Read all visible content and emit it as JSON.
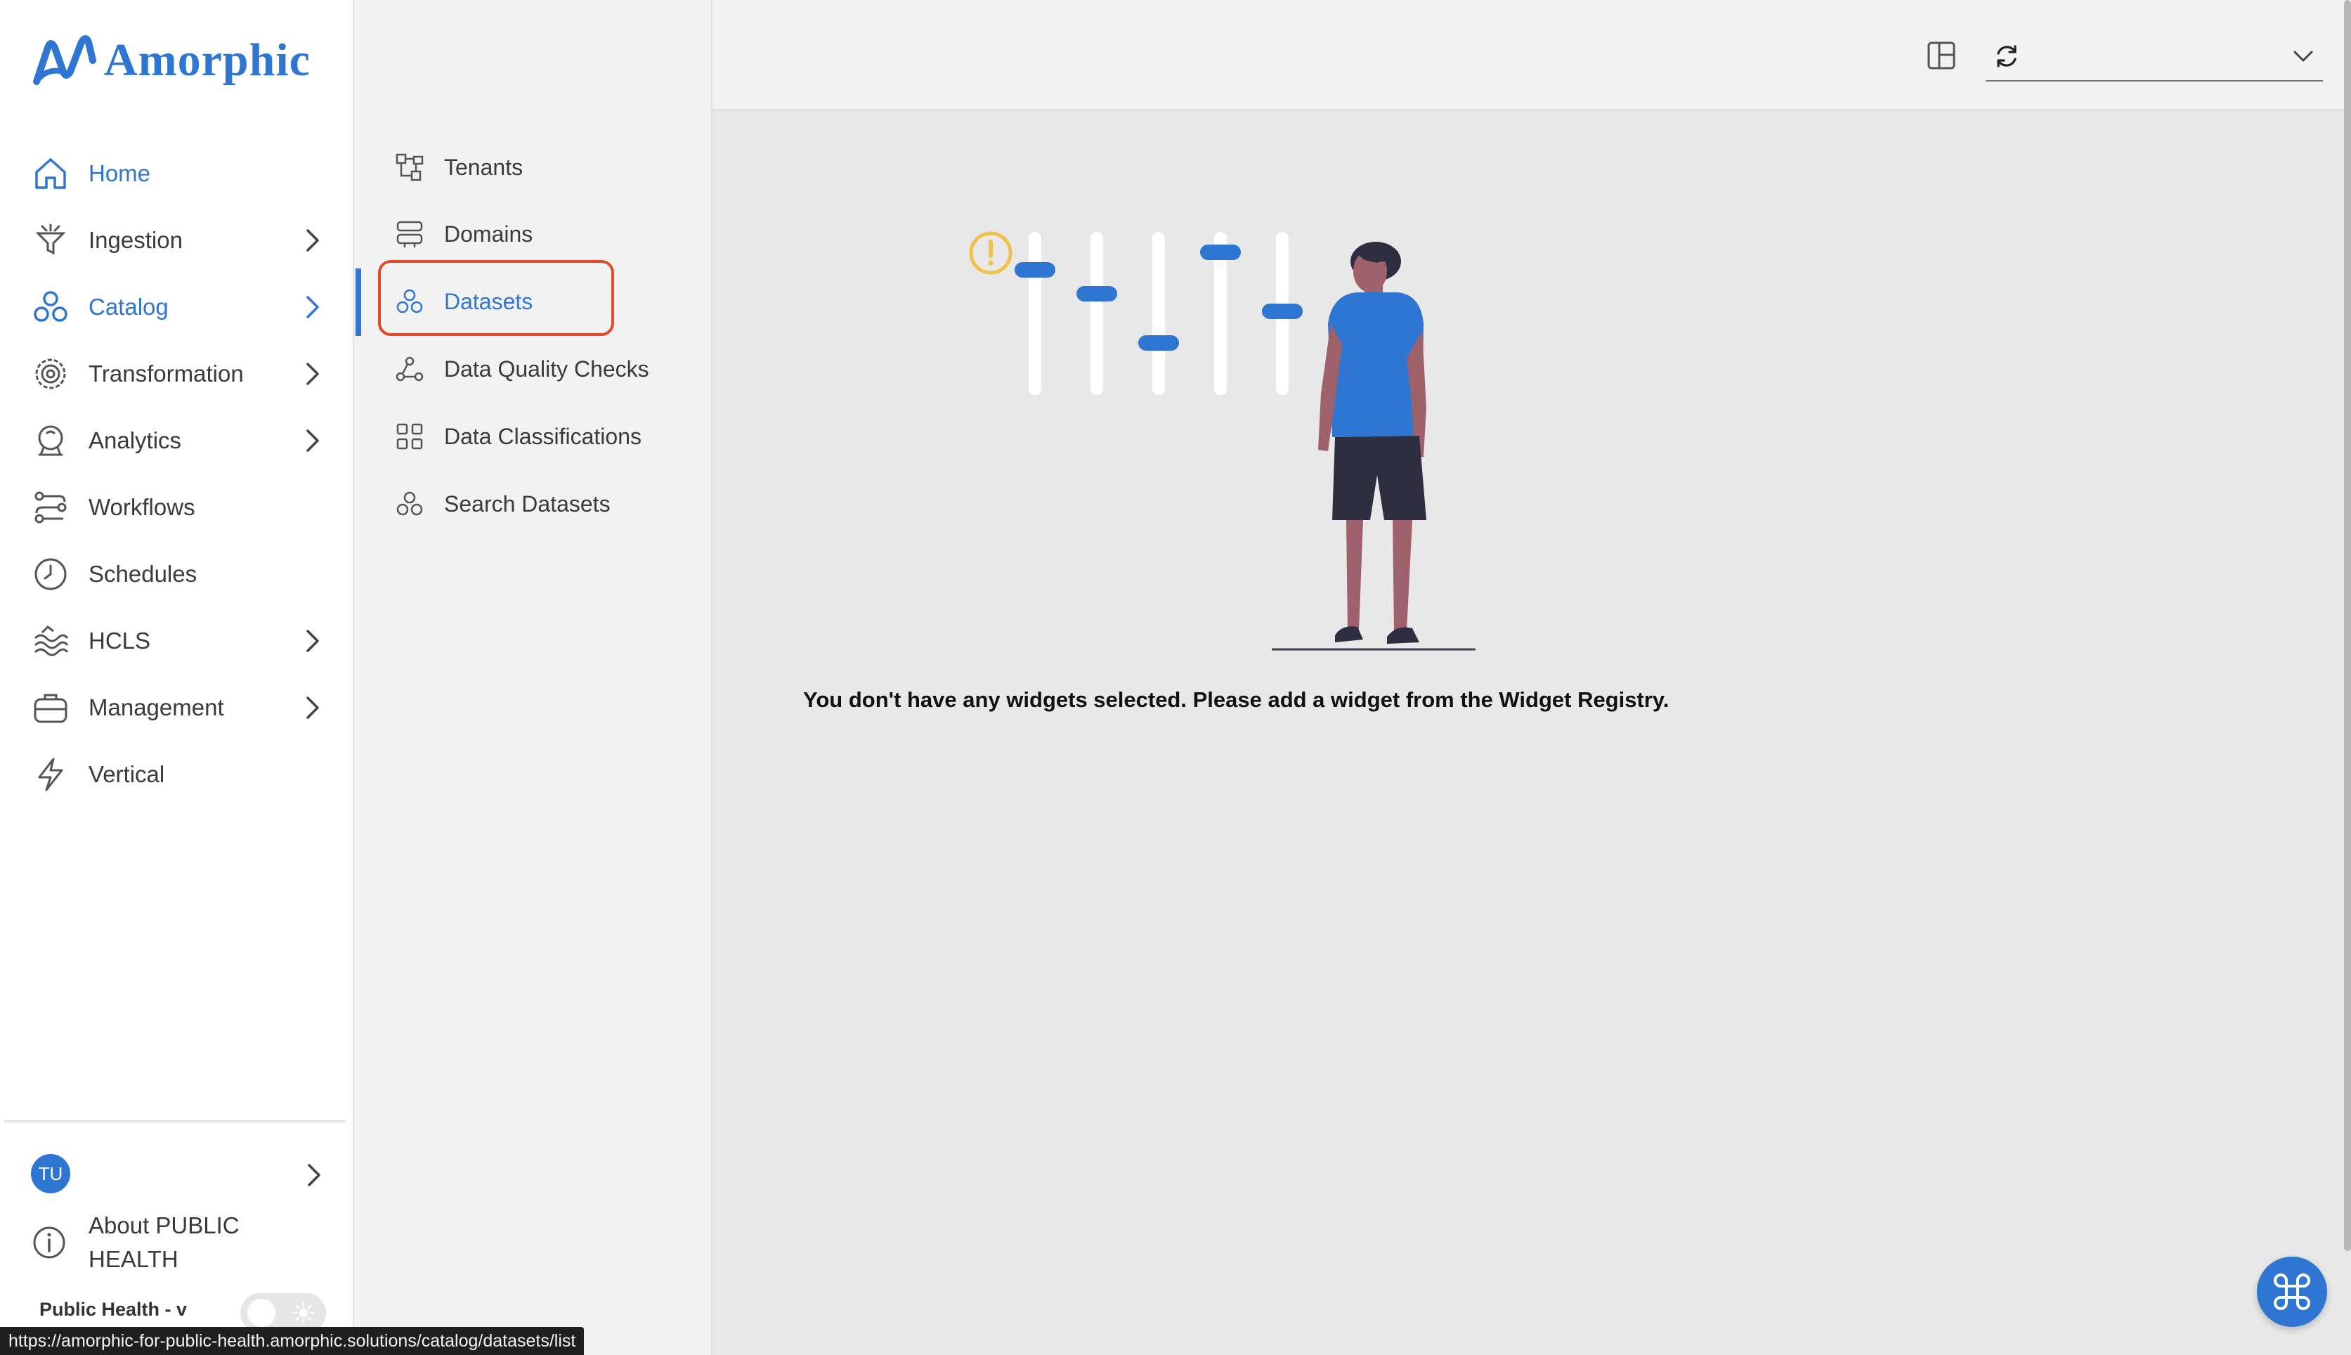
{
  "brand": {
    "name": "Amorphic",
    "accent": "#2f76d2"
  },
  "sidebar": {
    "items": [
      {
        "label": "Home",
        "icon": "home-icon",
        "active": true,
        "has_children": false
      },
      {
        "label": "Ingestion",
        "icon": "funnel-icon",
        "active": false,
        "has_children": true
      },
      {
        "label": "Catalog",
        "icon": "catalog-icon",
        "active": true,
        "has_children": true
      },
      {
        "label": "Transformation",
        "icon": "gear-icon",
        "active": false,
        "has_children": true
      },
      {
        "label": "Analytics",
        "icon": "analytics-icon",
        "active": false,
        "has_children": true
      },
      {
        "label": "Workflows",
        "icon": "workflow-icon",
        "active": false,
        "has_children": false
      },
      {
        "label": "Schedules",
        "icon": "clock-icon",
        "active": false,
        "has_children": false
      },
      {
        "label": "HCLS",
        "icon": "waves-icon",
        "active": false,
        "has_children": true
      },
      {
        "label": "Management",
        "icon": "briefcase-icon",
        "active": false,
        "has_children": true
      },
      {
        "label": "Vertical",
        "icon": "bolt-icon",
        "active": false,
        "has_children": false
      }
    ],
    "user_initials": "TU",
    "about_label": "About PUBLIC HEALTH",
    "tenant_label": "Public Health - v"
  },
  "submenu": {
    "items": [
      {
        "label": "Tenants",
        "icon": "tenants-icon"
      },
      {
        "label": "Domains",
        "icon": "domains-icon"
      },
      {
        "label": "Datasets",
        "icon": "datasets-icon",
        "active": true
      },
      {
        "label": "Data Quality Checks",
        "icon": "quality-icon"
      },
      {
        "label": "Data Classifications",
        "icon": "grid-icon"
      },
      {
        "label": "Search Datasets",
        "icon": "search-datasets-icon"
      }
    ]
  },
  "topbar": {
    "dashboard_value": ""
  },
  "main": {
    "empty_message": "You don't have any widgets selected. Please add a widget from the Widget Registry."
  },
  "status_bar": {
    "url": "https://amorphic-for-public-health.amorphic.solutions/catalog/datasets/list"
  }
}
